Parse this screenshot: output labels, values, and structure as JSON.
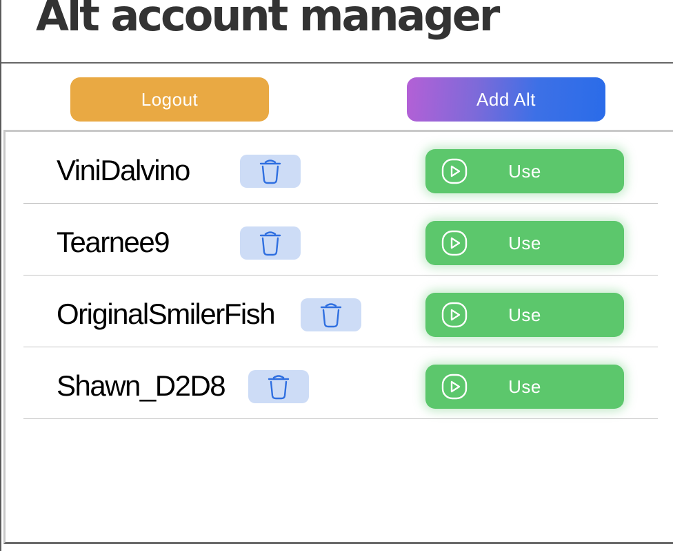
{
  "app": {
    "title": "Alt account manager"
  },
  "toolbar": {
    "logout_label": "Logout",
    "add_alt_label": "Add Alt"
  },
  "accounts": [
    {
      "name": "ViniDalvino",
      "use_label": "Use"
    },
    {
      "name": "Tearnee9",
      "use_label": "Use"
    },
    {
      "name": "OriginalSmilerFish",
      "use_label": "Use"
    },
    {
      "name": "Shawn_D2D8",
      "use_label": "Use"
    }
  ],
  "icons": {
    "delete": "trash-icon",
    "use": "play-circle-icon"
  },
  "colors": {
    "logout": "#e9a943",
    "add_alt_gradient_start": "#b460d6",
    "add_alt_gradient_end": "#2a6ce9",
    "use_button": "#5cc76c",
    "delete_button_bg": "#cddcf6",
    "delete_icon": "#2f6fe0",
    "title_text": "#333333"
  }
}
